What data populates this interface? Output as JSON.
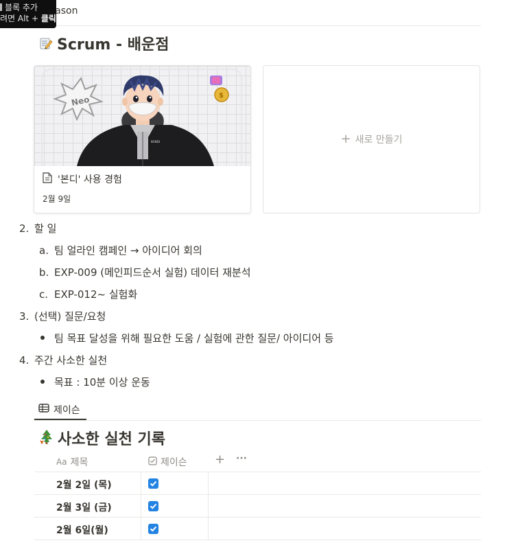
{
  "tooltip": {
    "line1": "블록 추가",
    "line2_prefix": "려면 Alt + ",
    "line2_bold": "클릭"
  },
  "top_tab": {
    "label": "Jason"
  },
  "page": {
    "title": "Scrum - 배운점"
  },
  "gallery": {
    "card": {
      "title": "'본디' 사용 경험",
      "date": "2월 9일"
    },
    "new_card": {
      "label": "새로 만들기"
    }
  },
  "list": {
    "item2": {
      "marker": "2.",
      "text": "할 일"
    },
    "item2_sub": [
      {
        "marker": "a.",
        "text": "팀 얼라인 캠페인 → 아이디어 회의"
      },
      {
        "marker": "b.",
        "text": "EXP-009 (메인피드순서 실험) 데이터 재분석"
      },
      {
        "marker": "c.",
        "text": "EXP-012~ 실험화"
      }
    ],
    "item3": {
      "marker": "3.",
      "text": "(선택) 질문/요청"
    },
    "item3_bullet": "팀 목표 달성을 위해 필요한 도움 / 실험에 관한 질문/ 아이디어 등",
    "item4": {
      "marker": "4.",
      "text": "주간 사소한 실천"
    },
    "item4_bullet": "목표 : 10분 이상 운동"
  },
  "database": {
    "view_tab": "제이슨",
    "title": "사소한 실천 기록",
    "columns": {
      "name_icon": "Aa",
      "name": "제목",
      "check": "제이슨",
      "add": "+",
      "more": "···"
    },
    "rows": [
      {
        "name": "2월 2일 (목)",
        "checked": true
      },
      {
        "name": "2월 3일 (금)",
        "checked": true
      },
      {
        "name": "2월 6일(월)",
        "checked": true
      }
    ]
  },
  "colors": {
    "checkbox": "#2383e2",
    "text": "#37352f",
    "muted": "#8e8c86"
  }
}
